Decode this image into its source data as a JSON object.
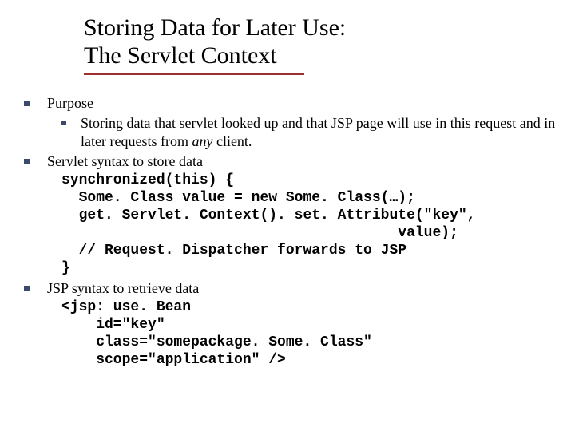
{
  "title": {
    "line1": "Storing Data for Later Use:",
    "line2": "The Servlet Context"
  },
  "sections": [
    {
      "heading": "Purpose",
      "sub_pre": "Storing data that servlet looked up and that JSP page will use in this request and in later requests from ",
      "sub_em": "any",
      "sub_post": " client."
    },
    {
      "heading": "Servlet syntax to store data",
      "code": "synchronized(this) {\n  Some. Class value = new Some. Class(…);\n  get. Servlet. Context(). set. Attribute(\"key\",\n                                       value);\n  // Request. Dispatcher forwards to JSP\n}"
    },
    {
      "heading": "JSP syntax to retrieve data",
      "code": "<jsp: use. Bean\n    id=\"key\"\n    class=\"somepackage. Some. Class\"\n    scope=\"application\" />"
    }
  ]
}
